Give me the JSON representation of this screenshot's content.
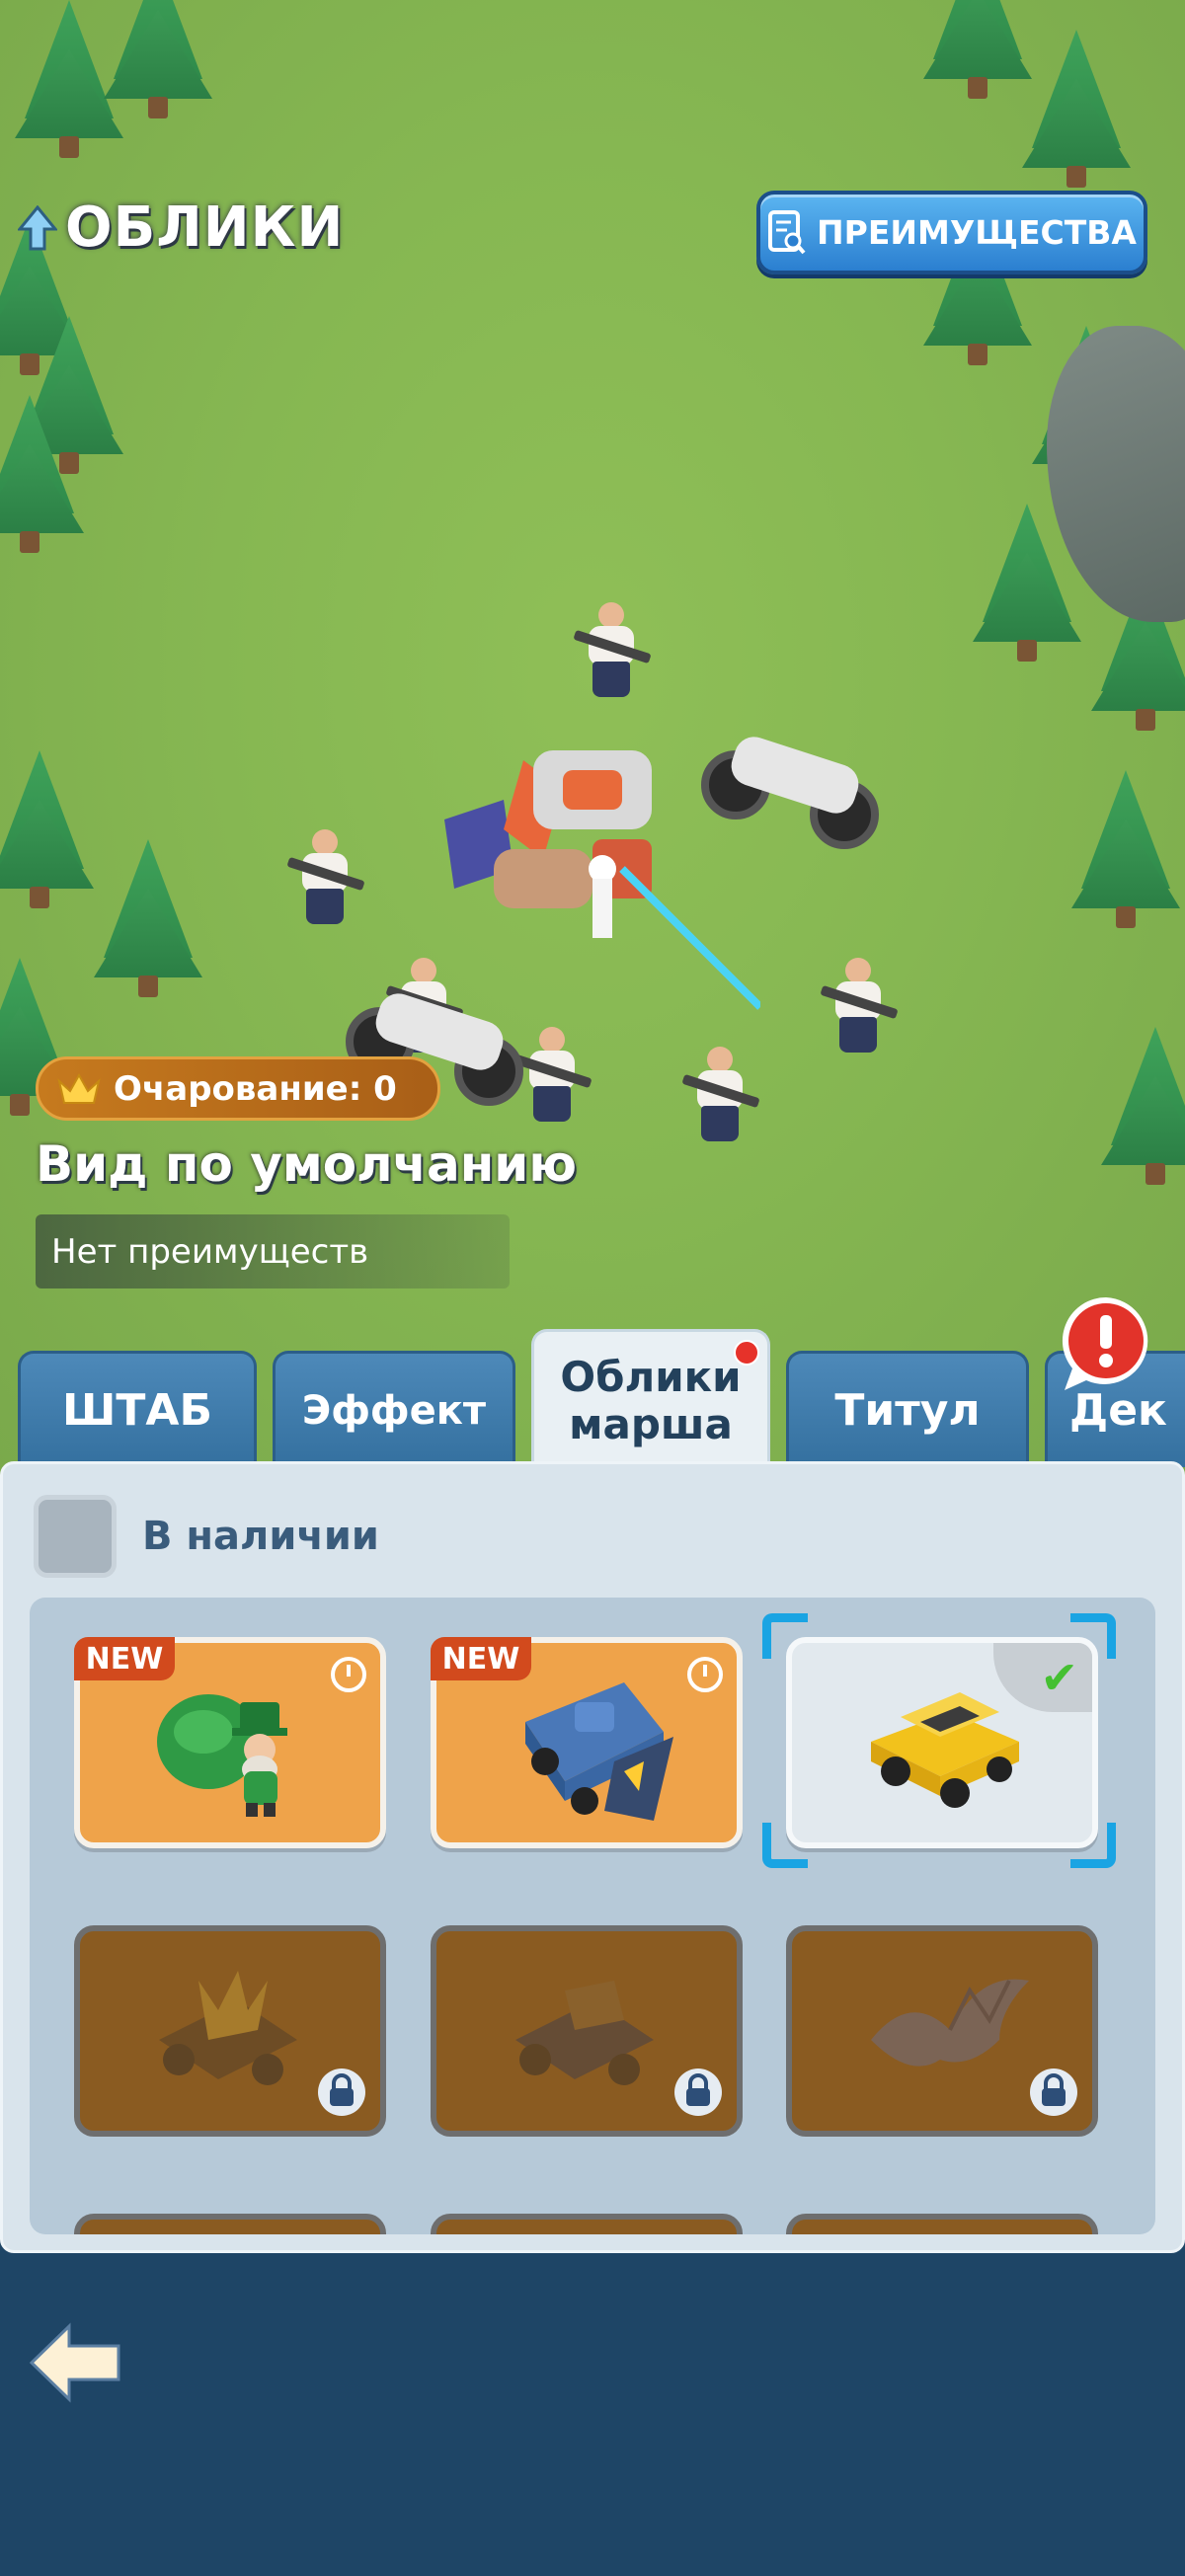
{
  "header": {
    "title": "ОБЛИКИ",
    "perks_button": "ПРЕИМУЩЕСТВА"
  },
  "charm": {
    "label": "Очарование: 0"
  },
  "skin": {
    "name": "Вид по умолчанию",
    "perks": "Нет преимуществ"
  },
  "tabs": [
    {
      "label": "ШТАБ",
      "active": false
    },
    {
      "label": "Эффект",
      "active": false
    },
    {
      "label": "Облики марша",
      "active": true,
      "badge": true
    },
    {
      "label": "Титул",
      "active": false
    },
    {
      "label": "Дек",
      "active": false
    }
  ],
  "filter": {
    "label": "В наличии",
    "checked": false
  },
  "cards": [
    {
      "state": "available",
      "badge": "NEW",
      "timer": true,
      "icon": "leprechaun-icon"
    },
    {
      "state": "available",
      "badge": "NEW",
      "timer": true,
      "icon": "armored-truck-icon"
    },
    {
      "state": "selected",
      "badge": "",
      "timer": false,
      "icon": "yellow-jeep-icon",
      "equipped": true
    },
    {
      "state": "locked",
      "icon": "spiked-chariot-icon"
    },
    {
      "state": "locked",
      "icon": "war-cart-icon"
    },
    {
      "state": "locked",
      "icon": "dragon-icon"
    }
  ],
  "colors": {
    "accent": "#2b7fd0",
    "panel": "#d9e4ec",
    "card_available": "#efa34a",
    "card_locked": "#8a5b21",
    "background": "#1e4566"
  }
}
